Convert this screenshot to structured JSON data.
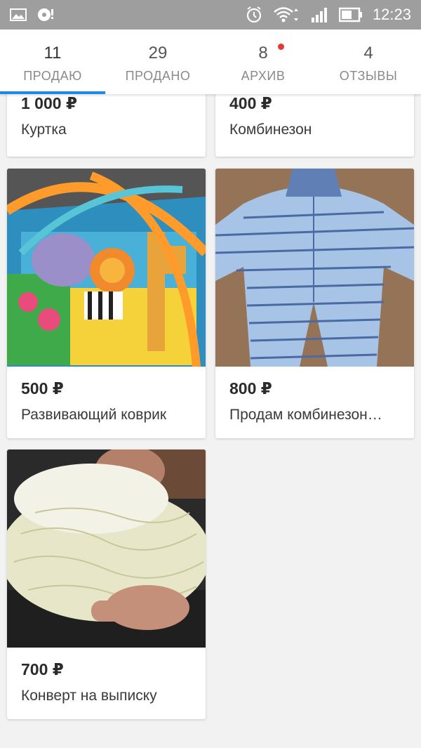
{
  "status_bar": {
    "time": "12:23",
    "icons": [
      "gallery-icon",
      "record-icon",
      "alarm-icon",
      "wifi-icon",
      "signal-icon",
      "battery-icon"
    ]
  },
  "tabs": [
    {
      "count": "11",
      "label": "ПРОДАЮ",
      "active": true
    },
    {
      "count": "29",
      "label": "ПРОДАНО",
      "active": false
    },
    {
      "count": "8",
      "label": "АРХИВ",
      "active": false,
      "has_dot": true
    },
    {
      "count": "4",
      "label": "ОТЗЫВЫ",
      "active": false
    }
  ],
  "listings": [
    {
      "price": "1 000 ₽",
      "title": "Куртка"
    },
    {
      "price": "400 ₽",
      "title": "Комбинезон"
    },
    {
      "price": "500 ₽",
      "title": "Развивающий коврик"
    },
    {
      "price": "800 ₽",
      "title": "Продам комбинезон…"
    },
    {
      "price": "700 ₽",
      "title": "Конверт на выписку"
    }
  ],
  "colors": {
    "accent": "#1e88e5",
    "status_bar": "#9e9e9e",
    "dot": "#e53935"
  }
}
